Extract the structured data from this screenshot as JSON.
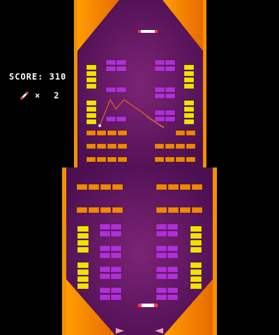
{
  "hud": {
    "score_label": "SCORE:",
    "score_value": "310",
    "lives_multiplier": "×",
    "lives_value": "2",
    "lives_icon": "paddle-icon"
  },
  "colors": {
    "background": "#000000",
    "field": "#6a1a6a",
    "wall_orange": "#f29100",
    "brick_yellow": "#f2e400",
    "brick_orange": "#f08800",
    "brick_purple": "#b030d8",
    "paddle": "#ff3a3a",
    "ball": "#ffffff",
    "trajectory": "#ff6a20"
  },
  "game": {
    "brick_layout_note_none": ""
  }
}
